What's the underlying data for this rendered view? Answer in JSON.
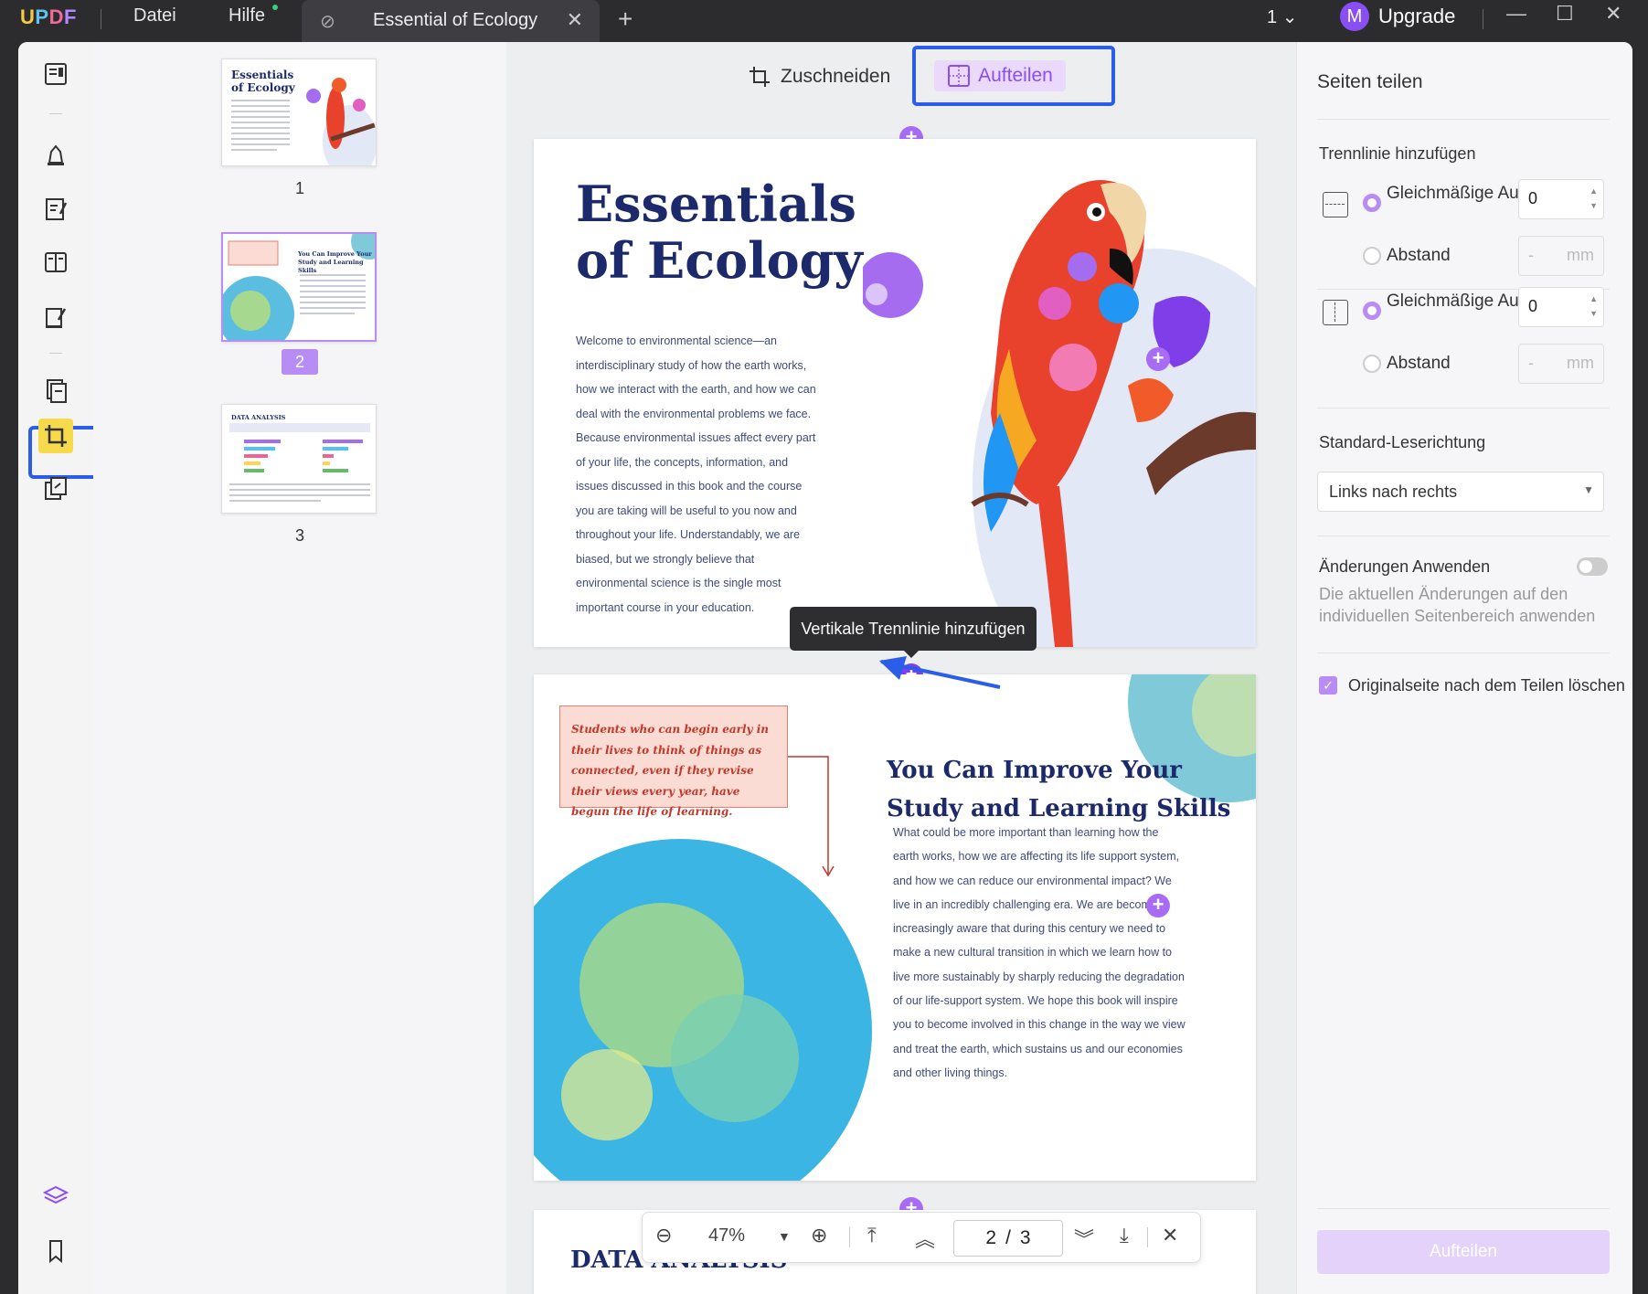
{
  "titlebar": {
    "logo": "UPDF",
    "menu": [
      "Datei",
      "Hilfe"
    ],
    "tab_title": "Essential of Ecology",
    "window_count": "1",
    "upgrade_avatar": "M",
    "upgrade_label": "Upgrade"
  },
  "thumbnails": {
    "pages": [
      {
        "number": "1",
        "title": "Essentials of Ecology"
      },
      {
        "number": "2",
        "title": "You Can Improve Your Study and Learning Skills"
      },
      {
        "number": "3",
        "title": "DATA ANALYSIS"
      }
    ],
    "selected": "2"
  },
  "viewer": {
    "crop_label": "Zuschneiden",
    "split_label": "Aufteilen",
    "tooltip": "Vertikale Trennlinie hinzufügen",
    "page1": {
      "title_line1": "Essentials",
      "title_line2": "of Ecology",
      "body": "Welcome to environmental science—an interdisciplinary study of how the earth works, how we interact with the earth, and how we can deal with the environmental problems we face. Because environmental issues affect every part of your life, the concepts, information, and issues discussed in this book and the course you are taking will be useful to you now and throughout your life. Understandably, we are biased, but we strongly believe that environmental science is the single most important course in your education."
    },
    "page2": {
      "quote": "Students who can begin early in their lives to think of things as connected, even if they revise their views every year, have begun the life of learning.",
      "title_line1": "You Can Improve Your",
      "title_line2": "Study and Learning Skills",
      "body": "What could be more important than learning how the earth works, how we are affecting its life support system, and how we can reduce our environmental impact? We live in an incredibly challenging era. We are becoming increasingly aware that during this century we need to make a new cultural transition in which we learn how to live more sustainably by sharply reducing the degradation of our life-support system. We hope this book will inspire you to become involved in this change in the way we view and treat the earth, which sustains us and our economies and other living things."
    },
    "page3": {
      "title": "DATA ANALYSIS"
    },
    "zoom": "47%",
    "current_page": "2",
    "page_sep": "/",
    "total_pages": "3"
  },
  "panel": {
    "title": "Seiten teilen",
    "section_divider": "Trennlinie hinzufügen",
    "horizontal": {
      "option1": "Gleichmäßige Aufteilung",
      "option2": "Abstand",
      "count": "0",
      "distance_placeholder": "-",
      "unit": "mm"
    },
    "vertical": {
      "option1": "Gleichmäßige Aufteilung",
      "option2": "Abstand",
      "count": "0",
      "distance_placeholder": "-",
      "unit": "mm"
    },
    "reading_direction_label": "Standard-Leserichtung",
    "reading_direction_value": "Links nach rechts",
    "apply_changes_label": "Änderungen Anwenden",
    "apply_changes_desc": "Die aktuellen Änderungen auf den individuellen Seitenbereich anwenden",
    "delete_original_label": "Originalseite nach dem Teilen löschen",
    "split_button": "Aufteilen"
  },
  "colors": {
    "accent": "#8a4ef5",
    "highlight_frame": "#2a5ee8",
    "heading": "#1c2a6b"
  }
}
